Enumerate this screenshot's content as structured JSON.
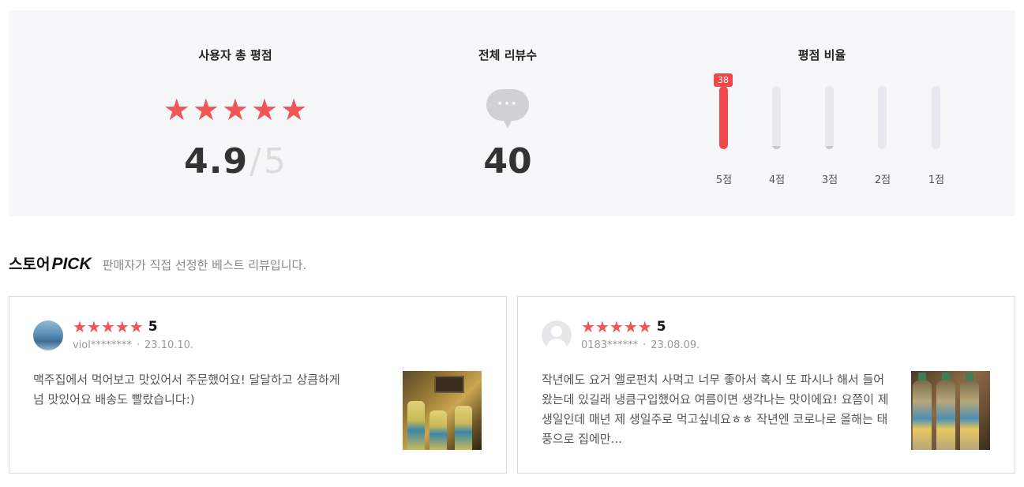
{
  "summary": {
    "score_title": "사용자 총 평점",
    "score_value": "4.9",
    "score_slash": "/",
    "score_max": "5",
    "count_title": "전체 리뷰수",
    "count_value": "40",
    "ratio_title": "평점 비율",
    "ratio_bars": [
      {
        "label": "5점",
        "badge": "38",
        "fraction": 1.0
      },
      {
        "label": "4점",
        "fraction": 0.05
      },
      {
        "label": "3점",
        "fraction": 0.05
      },
      {
        "label": "2점",
        "fraction": 0
      },
      {
        "label": "1점",
        "fraction": 0
      }
    ]
  },
  "pick": {
    "store_label": "스토어",
    "pick_label": "PICK",
    "description": "판매자가 직접 선정한 베스트 리뷰입니다."
  },
  "reviews": [
    {
      "rating": "5",
      "user": "viol********",
      "date": "23.10.10.",
      "text": "맥주집에서 먹어보고 맛있어서 주문했어요! 달달하고 상큼하게 넘 맛있어요 배송도 빨랐습니다:)"
    },
    {
      "rating": "5",
      "user": "0183******",
      "date": "23.08.09.",
      "text": "작년에도 요거 앨로펀치 사먹고 너무 좋아서 혹시 또 파시나 해서 들어왔는데 있길래 냉큼구입했어요 여름이면 생각나는 맛이에요! 요쯤이 제 생일인데 매년 제 생일주로 먹고싶네요ㅎㅎ 작년엔 코로나로 올해는 태풍으로 집에만..."
    }
  ],
  "colors": {
    "accent_red": "#f04848",
    "star_red": "#f15555",
    "panel_bg": "#f6f7f8"
  },
  "icons": {
    "star": "★",
    "bubble_dots": "···",
    "meta_dot": "·"
  }
}
